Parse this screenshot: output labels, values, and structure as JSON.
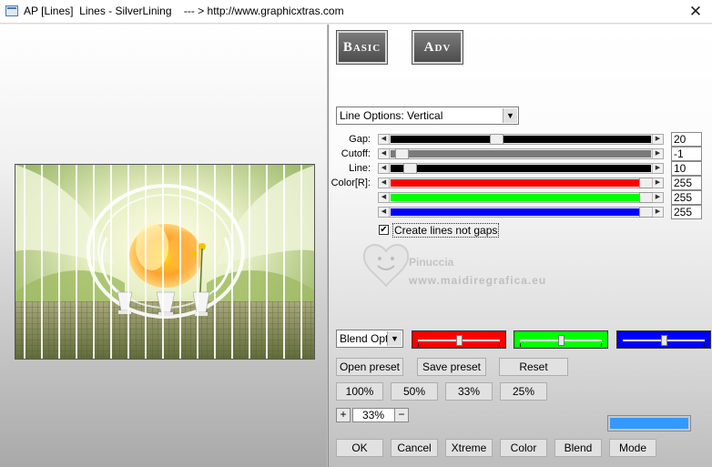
{
  "window": {
    "title": "AP [Lines]  Lines - SilverLining    --- > http://www.graphicxtras.com",
    "close_glyph": "✕"
  },
  "mode_buttons": {
    "basic": "Basic",
    "adv": "Adv"
  },
  "line_options": {
    "selected": "Line Options: Vertical"
  },
  "sliders": [
    {
      "label": "Gap:",
      "value": "20",
      "fraction": 0.4,
      "track_color": "#000000"
    },
    {
      "label": "Cutoff:",
      "value": "-1",
      "fraction": 0.02,
      "track_color": "#7a7a7a"
    },
    {
      "label": "Line:",
      "value": "10",
      "fraction": 0.05,
      "track_color": "#000000"
    },
    {
      "label": "Color[R]:",
      "value": "255",
      "fraction": 1.0,
      "track_color": "#ff0000"
    },
    {
      "label": "",
      "value": "255",
      "fraction": 1.0,
      "track_color": "#00ff00"
    },
    {
      "label": "",
      "value": "255",
      "fraction": 1.0,
      "track_color": "#0000ff"
    }
  ],
  "checkbox": {
    "label": "Create lines not gaps",
    "checked": true,
    "mark": "✔"
  },
  "watermark": {
    "line1": "Pinuccia",
    "line2": "www.maidiregrafica.eu"
  },
  "blend": {
    "selected": "Blend Optic"
  },
  "color_sliders": [
    {
      "color": "#ff0000",
      "fraction": 0.5
    },
    {
      "color": "#00ff00",
      "fraction": 0.5
    },
    {
      "color": "#0000ff",
      "fraction": 0.5
    }
  ],
  "preset_buttons": {
    "open": "Open preset",
    "save": "Save preset",
    "reset": "Reset"
  },
  "zoom_buttons": [
    "100%",
    "50%",
    "33%",
    "25%"
  ],
  "zoom_stepper": {
    "plus": "+",
    "minus": "−",
    "value": "33%"
  },
  "swatch_color": "#3399ff",
  "bottom_buttons": {
    "ok": "OK",
    "cancel": "Cancel",
    "xtreme": "Xtreme",
    "color": "Color",
    "blend": "Blend",
    "mode": "Mode"
  },
  "arrow_glyphs": {
    "left": "◀",
    "right": "▶",
    "down": "▼"
  }
}
